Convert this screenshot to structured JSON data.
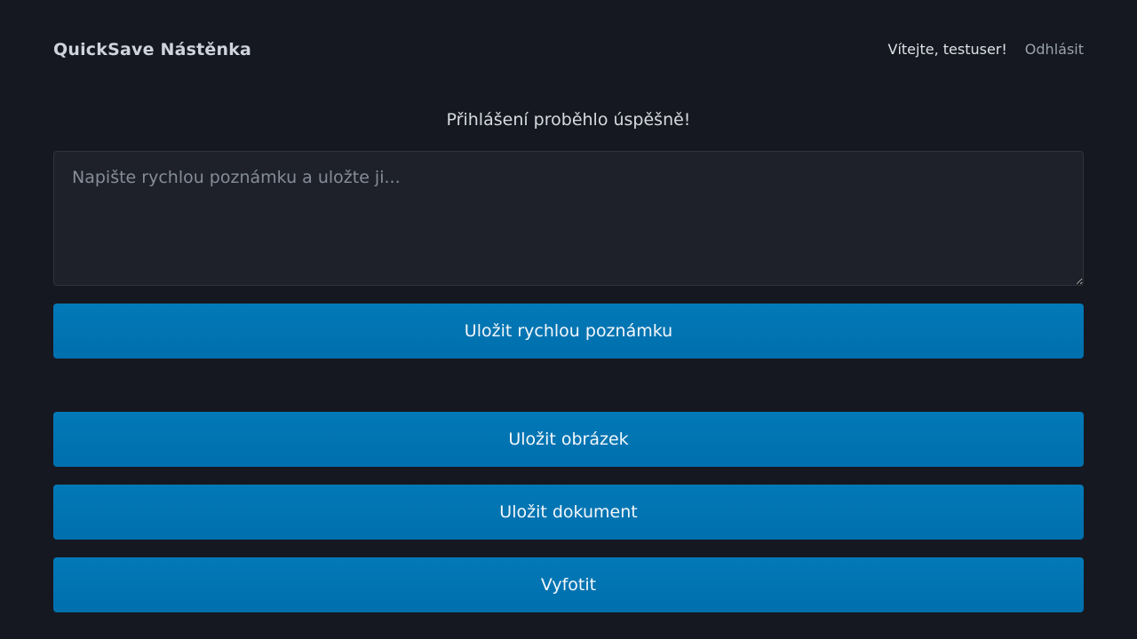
{
  "header": {
    "brand": "QuickSave Nástěnka",
    "welcome": "Vítejte, testuser!",
    "logout": "Odhlásit"
  },
  "flash": {
    "message": "Přihlášení proběhlo úspěšně!"
  },
  "note": {
    "placeholder": "Napište rychlou poznámku a uložte ji...",
    "value": "",
    "save_label": "Uložit rychlou poznámku"
  },
  "actions": {
    "save_image": "Uložit obrázek",
    "save_document": "Uložit dokument",
    "take_photo": "Vyfotit"
  },
  "colors": {
    "background": "#151820",
    "button": "#0075b2",
    "input_background": "#1e212a"
  }
}
